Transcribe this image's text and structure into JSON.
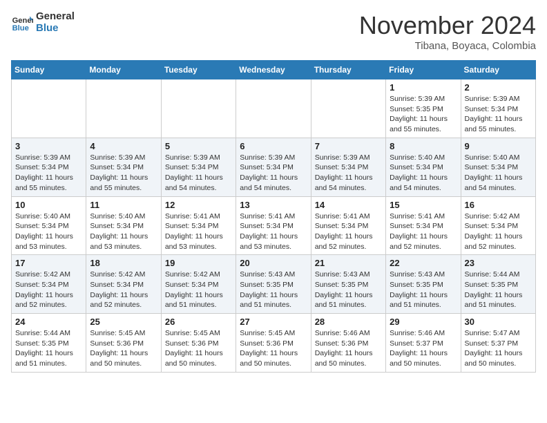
{
  "header": {
    "logo_line1": "General",
    "logo_line2": "Blue",
    "month": "November 2024",
    "location": "Tibana, Boyaca, Colombia"
  },
  "weekdays": [
    "Sunday",
    "Monday",
    "Tuesday",
    "Wednesday",
    "Thursday",
    "Friday",
    "Saturday"
  ],
  "weeks": [
    [
      {
        "day": "",
        "info": ""
      },
      {
        "day": "",
        "info": ""
      },
      {
        "day": "",
        "info": ""
      },
      {
        "day": "",
        "info": ""
      },
      {
        "day": "",
        "info": ""
      },
      {
        "day": "1",
        "info": "Sunrise: 5:39 AM\nSunset: 5:35 PM\nDaylight: 11 hours\nand 55 minutes."
      },
      {
        "day": "2",
        "info": "Sunrise: 5:39 AM\nSunset: 5:34 PM\nDaylight: 11 hours\nand 55 minutes."
      }
    ],
    [
      {
        "day": "3",
        "info": "Sunrise: 5:39 AM\nSunset: 5:34 PM\nDaylight: 11 hours\nand 55 minutes."
      },
      {
        "day": "4",
        "info": "Sunrise: 5:39 AM\nSunset: 5:34 PM\nDaylight: 11 hours\nand 55 minutes."
      },
      {
        "day": "5",
        "info": "Sunrise: 5:39 AM\nSunset: 5:34 PM\nDaylight: 11 hours\nand 54 minutes."
      },
      {
        "day": "6",
        "info": "Sunrise: 5:39 AM\nSunset: 5:34 PM\nDaylight: 11 hours\nand 54 minutes."
      },
      {
        "day": "7",
        "info": "Sunrise: 5:39 AM\nSunset: 5:34 PM\nDaylight: 11 hours\nand 54 minutes."
      },
      {
        "day": "8",
        "info": "Sunrise: 5:40 AM\nSunset: 5:34 PM\nDaylight: 11 hours\nand 54 minutes."
      },
      {
        "day": "9",
        "info": "Sunrise: 5:40 AM\nSunset: 5:34 PM\nDaylight: 11 hours\nand 54 minutes."
      }
    ],
    [
      {
        "day": "10",
        "info": "Sunrise: 5:40 AM\nSunset: 5:34 PM\nDaylight: 11 hours\nand 53 minutes."
      },
      {
        "day": "11",
        "info": "Sunrise: 5:40 AM\nSunset: 5:34 PM\nDaylight: 11 hours\nand 53 minutes."
      },
      {
        "day": "12",
        "info": "Sunrise: 5:41 AM\nSunset: 5:34 PM\nDaylight: 11 hours\nand 53 minutes."
      },
      {
        "day": "13",
        "info": "Sunrise: 5:41 AM\nSunset: 5:34 PM\nDaylight: 11 hours\nand 53 minutes."
      },
      {
        "day": "14",
        "info": "Sunrise: 5:41 AM\nSunset: 5:34 PM\nDaylight: 11 hours\nand 52 minutes."
      },
      {
        "day": "15",
        "info": "Sunrise: 5:41 AM\nSunset: 5:34 PM\nDaylight: 11 hours\nand 52 minutes."
      },
      {
        "day": "16",
        "info": "Sunrise: 5:42 AM\nSunset: 5:34 PM\nDaylight: 11 hours\nand 52 minutes."
      }
    ],
    [
      {
        "day": "17",
        "info": "Sunrise: 5:42 AM\nSunset: 5:34 PM\nDaylight: 11 hours\nand 52 minutes."
      },
      {
        "day": "18",
        "info": "Sunrise: 5:42 AM\nSunset: 5:34 PM\nDaylight: 11 hours\nand 52 minutes."
      },
      {
        "day": "19",
        "info": "Sunrise: 5:42 AM\nSunset: 5:34 PM\nDaylight: 11 hours\nand 51 minutes."
      },
      {
        "day": "20",
        "info": "Sunrise: 5:43 AM\nSunset: 5:35 PM\nDaylight: 11 hours\nand 51 minutes."
      },
      {
        "day": "21",
        "info": "Sunrise: 5:43 AM\nSunset: 5:35 PM\nDaylight: 11 hours\nand 51 minutes."
      },
      {
        "day": "22",
        "info": "Sunrise: 5:43 AM\nSunset: 5:35 PM\nDaylight: 11 hours\nand 51 minutes."
      },
      {
        "day": "23",
        "info": "Sunrise: 5:44 AM\nSunset: 5:35 PM\nDaylight: 11 hours\nand 51 minutes."
      }
    ],
    [
      {
        "day": "24",
        "info": "Sunrise: 5:44 AM\nSunset: 5:35 PM\nDaylight: 11 hours\nand 51 minutes."
      },
      {
        "day": "25",
        "info": "Sunrise: 5:45 AM\nSunset: 5:36 PM\nDaylight: 11 hours\nand 50 minutes."
      },
      {
        "day": "26",
        "info": "Sunrise: 5:45 AM\nSunset: 5:36 PM\nDaylight: 11 hours\nand 50 minutes."
      },
      {
        "day": "27",
        "info": "Sunrise: 5:45 AM\nSunset: 5:36 PM\nDaylight: 11 hours\nand 50 minutes."
      },
      {
        "day": "28",
        "info": "Sunrise: 5:46 AM\nSunset: 5:36 PM\nDaylight: 11 hours\nand 50 minutes."
      },
      {
        "day": "29",
        "info": "Sunrise: 5:46 AM\nSunset: 5:37 PM\nDaylight: 11 hours\nand 50 minutes."
      },
      {
        "day": "30",
        "info": "Sunrise: 5:47 AM\nSunset: 5:37 PM\nDaylight: 11 hours\nand 50 minutes."
      }
    ]
  ]
}
